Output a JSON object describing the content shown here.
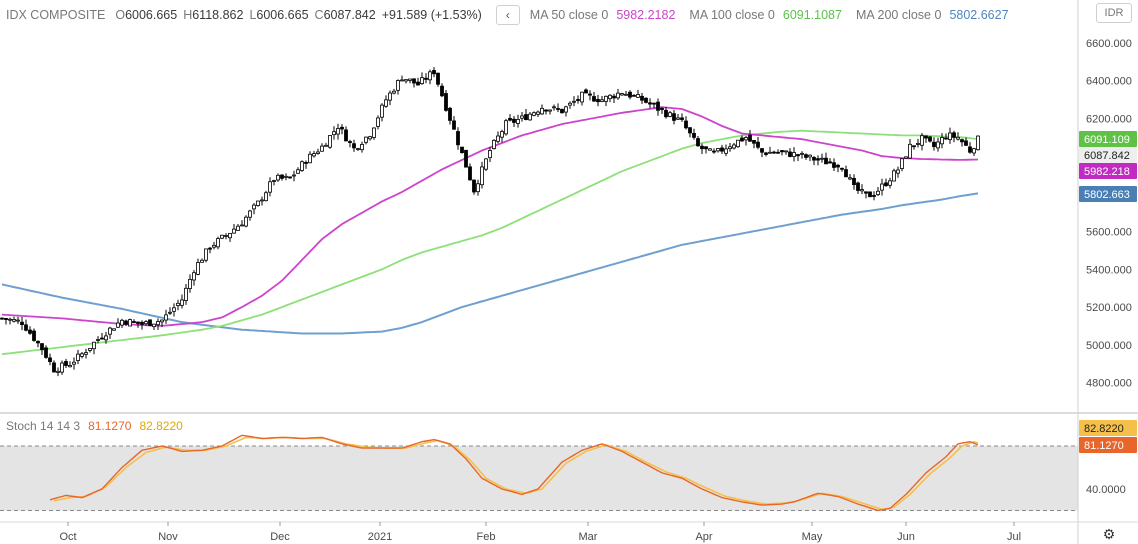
{
  "header": {
    "symbol": "IDX COMPOSITE",
    "open_label": "O",
    "open": "6006.665",
    "high_label": "H",
    "high": "6118.862",
    "low_label": "L",
    "low": "6006.665",
    "close_label": "C",
    "close": "6087.842",
    "change": "+91.589 (+1.53%)",
    "collapse_glyph": "‹",
    "ma50_label": "MA 50 close 0",
    "ma50_value": "5982.2182",
    "ma100_label": "MA 100 close 0",
    "ma100_value": "6091.1087",
    "ma200_label": "MA 200 close 0",
    "ma200_value": "5802.6627"
  },
  "currency": "IDR",
  "stoch": {
    "label": "Stoch 14 14 3",
    "k_value": "81.1270",
    "d_value": "82.8220"
  },
  "gear_icon": "⚙",
  "colors": {
    "ma50": "#cc44cc",
    "ma100": "#8ee07a",
    "ma200": "#6f9fcf",
    "stoch_k": "#e8662a",
    "stoch_d": "#f5c04a",
    "close_badge": "#eeeeee"
  },
  "chart_data": [
    {
      "type": "candlestick",
      "title": "IDX COMPOSITE",
      "yticks": [
        "6600.000",
        "6400.000",
        "6200.000",
        "6000.000",
        "5800.000",
        "5600.000",
        "5400.000",
        "5200.000",
        "5000.000",
        "4800.000"
      ],
      "ylim": [
        4700,
        6700
      ],
      "xticks": [
        "Oct",
        "Nov",
        "Dec",
        "2021",
        "Feb",
        "Mar",
        "Apr",
        "May",
        "Jun",
        "Jul"
      ],
      "last_value_labels": [
        "6091.109",
        "6087.842",
        "5982.218",
        "5802.663"
      ],
      "close_anchors": [
        [
          0,
          5140
        ],
        [
          5,
          5120
        ],
        [
          10,
          4980
        ],
        [
          13,
          4870
        ],
        [
          17,
          4900
        ],
        [
          20,
          4950
        ],
        [
          25,
          5050
        ],
        [
          30,
          5130
        ],
        [
          35,
          5110
        ],
        [
          40,
          5130
        ],
        [
          45,
          5240
        ],
        [
          48,
          5400
        ],
        [
          52,
          5520
        ],
        [
          56,
          5580
        ],
        [
          60,
          5650
        ],
        [
          64,
          5750
        ],
        [
          68,
          5880
        ],
        [
          72,
          5880
        ],
        [
          76,
          5980
        ],
        [
          80,
          6050
        ],
        [
          84,
          6160
        ],
        [
          88,
          6040
        ],
        [
          92,
          6120
        ],
        [
          96,
          6300
        ],
        [
          100,
          6420
        ],
        [
          104,
          6380
        ],
        [
          108,
          6450
        ],
        [
          112,
          6200
        ],
        [
          116,
          5950
        ],
        [
          118,
          5820
        ],
        [
          122,
          6030
        ],
        [
          126,
          6170
        ],
        [
          130,
          6200
        ],
        [
          135,
          6260
        ],
        [
          140,
          6240
        ],
        [
          145,
          6320
        ],
        [
          150,
          6300
        ],
        [
          155,
          6340
        ],
        [
          160,
          6300
        ],
        [
          165,
          6240
        ],
        [
          170,
          6180
        ],
        [
          174,
          6050
        ],
        [
          178,
          6010
        ],
        [
          182,
          6060
        ],
        [
          186,
          6100
        ],
        [
          190,
          6020
        ],
        [
          194,
          6020
        ],
        [
          198,
          6010
        ],
        [
          202,
          5990
        ],
        [
          206,
          5970
        ],
        [
          210,
          5950
        ],
        [
          213,
          5830
        ],
        [
          216,
          5790
        ],
        [
          218,
          5800
        ],
        [
          221,
          5860
        ],
        [
          224,
          5930
        ],
        [
          227,
          6050
        ],
        [
          230,
          6090
        ],
        [
          233,
          6050
        ],
        [
          236,
          6110
        ],
        [
          239,
          6100
        ],
        [
          242,
          6030
        ],
        [
          244,
          6087.842
        ]
      ],
      "ma50_anchors": [
        [
          0,
          5160
        ],
        [
          15,
          5140
        ],
        [
          30,
          5110
        ],
        [
          40,
          5100
        ],
        [
          50,
          5120
        ],
        [
          55,
          5145
        ],
        [
          60,
          5200
        ],
        [
          65,
          5260
        ],
        [
          70,
          5340
        ],
        [
          75,
          5450
        ],
        [
          80,
          5560
        ],
        [
          85,
          5640
        ],
        [
          90,
          5700
        ],
        [
          95,
          5760
        ],
        [
          100,
          5810
        ],
        [
          105,
          5870
        ],
        [
          110,
          5930
        ],
        [
          115,
          5980
        ],
        [
          120,
          6030
        ],
        [
          125,
          6070
        ],
        [
          130,
          6110
        ],
        [
          135,
          6140
        ],
        [
          140,
          6170
        ],
        [
          145,
          6190
        ],
        [
          150,
          6210
        ],
        [
          155,
          6230
        ],
        [
          160,
          6245
        ],
        [
          165,
          6260
        ],
        [
          170,
          6250
        ],
        [
          175,
          6210
        ],
        [
          180,
          6160
        ],
        [
          185,
          6120
        ],
        [
          190,
          6110
        ],
        [
          195,
          6100
        ],
        [
          200,
          6090
        ],
        [
          205,
          6070
        ],
        [
          210,
          6050
        ],
        [
          215,
          6030
        ],
        [
          220,
          6000
        ],
        [
          225,
          5990
        ],
        [
          230,
          5985
        ],
        [
          235,
          5982
        ],
        [
          240,
          5980
        ],
        [
          244,
          5982.218
        ]
      ],
      "ma100_anchors": [
        [
          0,
          4950
        ],
        [
          20,
          5000
        ],
        [
          40,
          5050
        ],
        [
          50,
          5080
        ],
        [
          55,
          5100
        ],
        [
          60,
          5130
        ],
        [
          65,
          5160
        ],
        [
          70,
          5200
        ],
        [
          75,
          5240
        ],
        [
          80,
          5280
        ],
        [
          85,
          5320
        ],
        [
          90,
          5360
        ],
        [
          95,
          5400
        ],
        [
          100,
          5450
        ],
        [
          105,
          5490
        ],
        [
          110,
          5520
        ],
        [
          115,
          5550
        ],
        [
          120,
          5580
        ],
        [
          125,
          5620
        ],
        [
          130,
          5670
        ],
        [
          135,
          5720
        ],
        [
          140,
          5770
        ],
        [
          145,
          5820
        ],
        [
          150,
          5870
        ],
        [
          155,
          5920
        ],
        [
          160,
          5960
        ],
        [
          165,
          6000
        ],
        [
          170,
          6040
        ],
        [
          175,
          6070
        ],
        [
          180,
          6090
        ],
        [
          185,
          6110
        ],
        [
          190,
          6120
        ],
        [
          195,
          6130
        ],
        [
          200,
          6135
        ],
        [
          205,
          6130
        ],
        [
          210,
          6125
        ],
        [
          215,
          6120
        ],
        [
          220,
          6115
        ],
        [
          225,
          6110
        ],
        [
          230,
          6110
        ],
        [
          235,
          6105
        ],
        [
          240,
          6100
        ],
        [
          244,
          6091.109
        ]
      ],
      "ma200_anchors": [
        [
          0,
          5320
        ],
        [
          15,
          5250
        ],
        [
          30,
          5190
        ],
        [
          45,
          5120
        ],
        [
          60,
          5080
        ],
        [
          75,
          5060
        ],
        [
          85,
          5060
        ],
        [
          95,
          5070
        ],
        [
          100,
          5090
        ],
        [
          105,
          5120
        ],
        [
          110,
          5160
        ],
        [
          115,
          5200
        ],
        [
          120,
          5230
        ],
        [
          125,
          5260
        ],
        [
          130,
          5290
        ],
        [
          135,
          5320
        ],
        [
          140,
          5350
        ],
        [
          145,
          5380
        ],
        [
          150,
          5410
        ],
        [
          155,
          5440
        ],
        [
          160,
          5470
        ],
        [
          165,
          5500
        ],
        [
          170,
          5530
        ],
        [
          175,
          5550
        ],
        [
          180,
          5570
        ],
        [
          185,
          5590
        ],
        [
          190,
          5610
        ],
        [
          195,
          5630
        ],
        [
          200,
          5650
        ],
        [
          205,
          5670
        ],
        [
          210,
          5690
        ],
        [
          215,
          5705
        ],
        [
          220,
          5720
        ],
        [
          225,
          5740
        ],
        [
          230,
          5755
        ],
        [
          235,
          5770
        ],
        [
          240,
          5790
        ],
        [
          244,
          5802.663
        ]
      ]
    },
    {
      "type": "line",
      "title": "Stoch 14 14 3",
      "yticks": [
        "40.0000"
      ],
      "ylim": [
        0,
        100
      ],
      "bands": [
        20,
        80
      ],
      "last_value_labels": [
        "82.8220",
        "81.1270"
      ],
      "k_anchors": [
        [
          12,
          30
        ],
        [
          16,
          34
        ],
        [
          20,
          32
        ],
        [
          25,
          40
        ],
        [
          30,
          60
        ],
        [
          35,
          76
        ],
        [
          40,
          80
        ],
        [
          45,
          75
        ],
        [
          50,
          76
        ],
        [
          55,
          80
        ],
        [
          60,
          90
        ],
        [
          65,
          87
        ],
        [
          70,
          88
        ],
        [
          75,
          87
        ],
        [
          80,
          88
        ],
        [
          85,
          82
        ],
        [
          90,
          78
        ],
        [
          95,
          78
        ],
        [
          100,
          78
        ],
        [
          105,
          84
        ],
        [
          108,
          86
        ],
        [
          112,
          82
        ],
        [
          116,
          68
        ],
        [
          120,
          50
        ],
        [
          125,
          40
        ],
        [
          130,
          35
        ],
        [
          134,
          40
        ],
        [
          140,
          65
        ],
        [
          145,
          76
        ],
        [
          150,
          82
        ],
        [
          155,
          75
        ],
        [
          160,
          65
        ],
        [
          165,
          55
        ],
        [
          170,
          50
        ],
        [
          175,
          40
        ],
        [
          180,
          32
        ],
        [
          185,
          28
        ],
        [
          190,
          25
        ],
        [
          195,
          26
        ],
        [
          198,
          28
        ],
        [
          204,
          36
        ],
        [
          209,
          33
        ],
        [
          214,
          26
        ],
        [
          219,
          20
        ],
        [
          222,
          22
        ],
        [
          226,
          35
        ],
        [
          231,
          55
        ],
        [
          236,
          70
        ],
        [
          239,
          82
        ],
        [
          242,
          84
        ],
        [
          244,
          81
        ]
      ],
      "d_anchors": [
        [
          13,
          29
        ],
        [
          17,
          32
        ],
        [
          21,
          33
        ],
        [
          26,
          42
        ],
        [
          31,
          60
        ],
        [
          36,
          74
        ],
        [
          41,
          79
        ],
        [
          46,
          76
        ],
        [
          51,
          76
        ],
        [
          56,
          80
        ],
        [
          61,
          88
        ],
        [
          66,
          87
        ],
        [
          71,
          88
        ],
        [
          76,
          87
        ],
        [
          81,
          87
        ],
        [
          86,
          82
        ],
        [
          91,
          79
        ],
        [
          96,
          78
        ],
        [
          101,
          78
        ],
        [
          106,
          83
        ],
        [
          109,
          85
        ],
        [
          113,
          80
        ],
        [
          117,
          67
        ],
        [
          121,
          50
        ],
        [
          126,
          40
        ],
        [
          131,
          36
        ],
        [
          135,
          40
        ],
        [
          141,
          64
        ],
        [
          146,
          75
        ],
        [
          151,
          81
        ],
        [
          156,
          75
        ],
        [
          161,
          65
        ],
        [
          166,
          56
        ],
        [
          171,
          50
        ],
        [
          176,
          41
        ],
        [
          181,
          33
        ],
        [
          186,
          29
        ],
        [
          191,
          26
        ],
        [
          196,
          27
        ],
        [
          199,
          29
        ],
        [
          205,
          36
        ],
        [
          210,
          33
        ],
        [
          215,
          27
        ],
        [
          220,
          21
        ],
        [
          223,
          23
        ],
        [
          227,
          35
        ],
        [
          232,
          54
        ],
        [
          237,
          69
        ],
        [
          240,
          80
        ],
        [
          243,
          84
        ],
        [
          244,
          82.8
        ]
      ]
    }
  ]
}
